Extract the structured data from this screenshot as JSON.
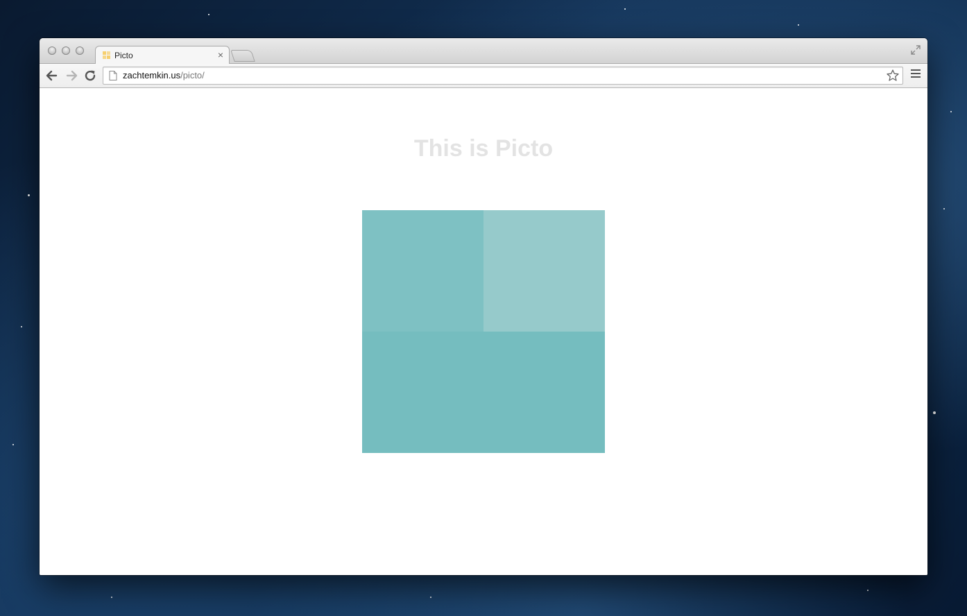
{
  "window": {
    "tab": {
      "title": "Picto"
    }
  },
  "toolbar": {
    "url_host": "zachtemkin.us",
    "url_path": "/picto/"
  },
  "page": {
    "heading": "This is Picto"
  },
  "picto": {
    "tiles": [
      {
        "name": "top-left",
        "color": "#7ec1c3"
      },
      {
        "name": "top-right",
        "color": "#96cacb"
      },
      {
        "name": "bottom",
        "color": "#75bdbf"
      }
    ]
  },
  "colors": {
    "heading": "#e3e3e3",
    "desktop": "#123155"
  },
  "icons": {
    "back": "arrow-left-icon",
    "forward": "arrow-right-icon",
    "reload": "reload-icon",
    "bookmark": "star-icon",
    "menu": "hamburger-menu-icon",
    "fullscreen": "fullscreen-icon",
    "page": "page-icon",
    "close": "close-icon"
  }
}
